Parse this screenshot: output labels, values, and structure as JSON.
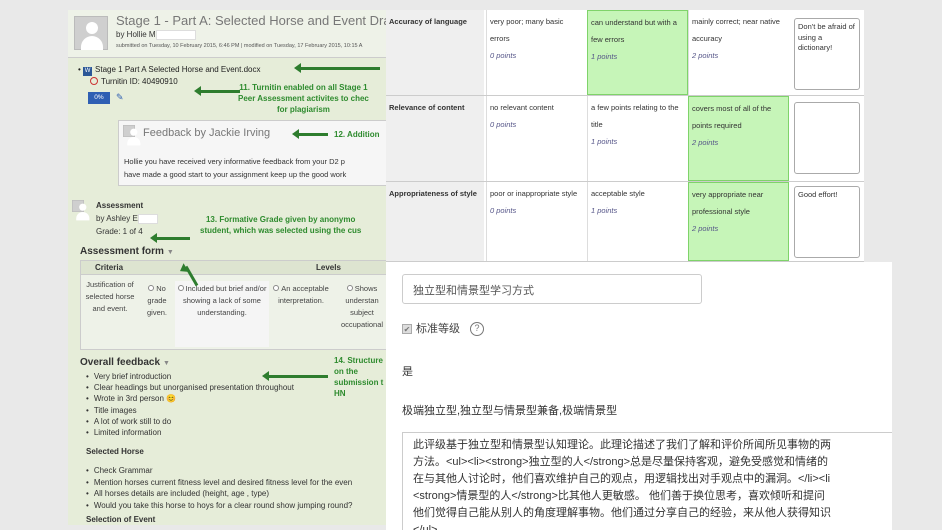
{
  "left": {
    "submission": {
      "title": "Stage 1 - Part A: Selected Horse and Event Draf",
      "by": "by Hollie M",
      "meta_submitted": "submitted on Tuesday, 10 February 2015, 6:46 PM",
      "meta_modified": "modified on Tuesday, 17 February 2015, 10:15 A",
      "file_name": "Stage 1 Part A Selected Horse and Event.docx",
      "turnitin_id": "Turnitin ID: 40490910",
      "similarity": "0%"
    },
    "feedback": {
      "title": "Feedback by Jackie Irving",
      "text_line1": "Hollie you have received very informative feedback from your D2 p",
      "text_line2": "have made a good start to your assignment keep up the good work"
    },
    "assessment": {
      "title": "Assessment",
      "by": "by Ashley E",
      "grade": "Grade: 1 of 4"
    },
    "assessment_form": {
      "title": "Assessment form",
      "criteria_header": "Criteria",
      "levels_header": "Levels",
      "criterion": "Justification of selected horse and event.",
      "levels": [
        "No grade given.",
        "Included but brief and/or showing a lack of some understanding.",
        "An acceptable interpretation.",
        "Shows understan subject occupational"
      ]
    },
    "overall_feedback": {
      "title": "Overall feedback",
      "items": [
        "Very brief introduction",
        "Clear headings but unorganised presentation throughout",
        "Wrote in 3rd person 😊",
        "Title images",
        "A lot of work still to do",
        "Limited information"
      ],
      "selected_horse_title": "Selected Horse",
      "selected_horse_items": [
        "Check Grammar",
        "Mention horses current fitness level and desired fitness level for the even",
        "All horses details are included (height, age , type)",
        "Would you take this horse to hoys for a clear round show jumping round?"
      ],
      "selection_event_title": "Selection of Event"
    },
    "notes": {
      "n11": "11. Turnitin enabled on all Stage 1\nPeer Assessment activites to chec\nfor plagiarism",
      "n12": "12. Addition",
      "n13": "13. Formative Grade given by anonymo\nstudent, which was selected using the cus",
      "n14": "14. Structure\non the\nsubmission t\nHN"
    }
  },
  "rubric": {
    "rows": [
      {
        "criterion": "Accuracy of language",
        "levels": [
          {
            "text": "very poor; many basic errors",
            "points": "0 points"
          },
          {
            "text": "can understand but with a few errors",
            "points": "1 points"
          },
          {
            "text": "mainly correct; near native accuracy",
            "points": "2 points"
          }
        ],
        "selected": 1,
        "note": "Don't be afraid of using a dictionary!"
      },
      {
        "criterion": "Relevance of content",
        "levels": [
          {
            "text": "no relevant content",
            "points": "0 points"
          },
          {
            "text": "a few points relating to the title",
            "points": "1 points"
          },
          {
            "text": "covers most of all of the points required",
            "points": "2 points"
          }
        ],
        "selected": 2,
        "note": ""
      },
      {
        "criterion": "Appropriateness of style",
        "levels": [
          {
            "text": "poor or inappropriate style",
            "points": "0 points"
          },
          {
            "text": "acceptable style",
            "points": "1 points"
          },
          {
            "text": "very appropriate near professional style",
            "points": "2 points"
          }
        ],
        "selected": 2,
        "note": "Good effort!"
      }
    ]
  },
  "form": {
    "name_value": "独立型和情景型学习方式",
    "standard_label": "标准等级",
    "yes_text": "是",
    "levels_text": "极端独立型,独立型与情景型兼备,极端情景型",
    "description_lines": [
      "此评级基于独立型和情景型认知理论。此理论描述了我们了解和评价所闻所见事物的两",
      "方法。<ul><li><strong>独立型的人</strong>总是尽量保持客观，避免受感觉和情绪的",
      "在与其他人讨论时，他们喜欢维护自己的观点，用逻辑找出对手观点中的漏洞。</li><li",
      "<strong>情景型的人</strong>比其他人更敏感。 他们善于换位思考，喜欢倾听和提问",
      "他们觉得自己能从别人的角度理解事物。他们通过分享自己的经验，来从他人获得知识",
      "</ul>"
    ]
  }
}
